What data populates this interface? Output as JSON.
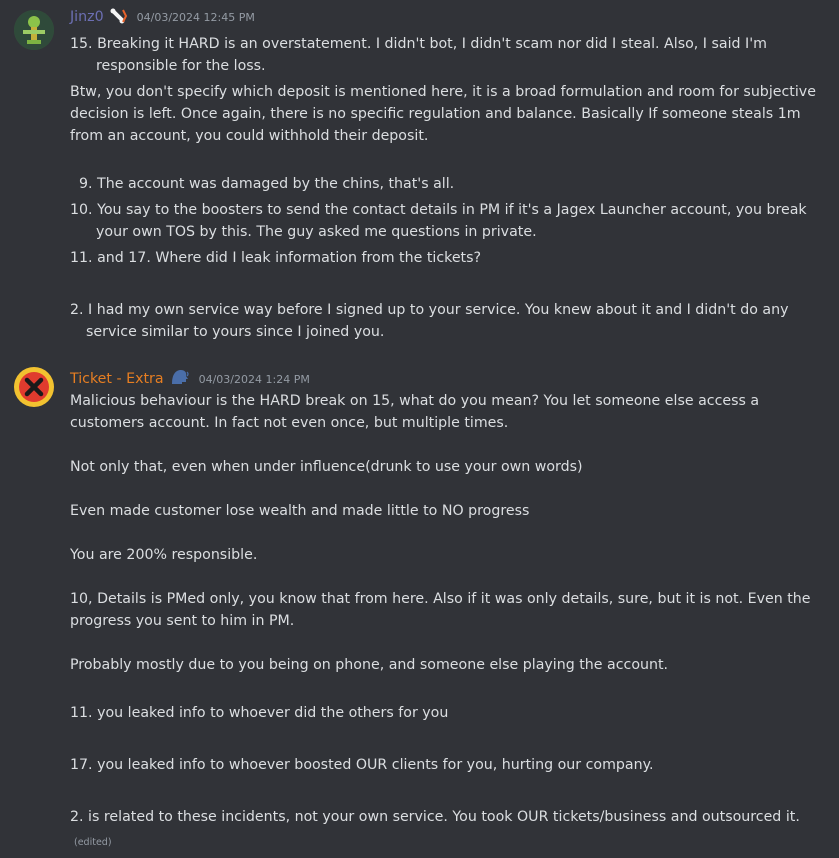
{
  "messages": [
    {
      "author": "Jinz0",
      "author_color": "#6c6fb3",
      "timestamp": "04/03/2024 12:45 PM",
      "badge_icon": "bone-icon",
      "lines": [
        "15. Breaking it HARD is an overstatement. I didn't bot, I didn't scam nor did I steal. Also, I said I'm",
        "responsible for the loss.",
        "Btw, you don't specify which deposit is mentioned here, it is a broad formulation and room for subjective",
        "decision is left. Once again, there is no specific regulation and balance. Basically If someone steals 1m",
        "from an account, you could withhold their deposit.",
        "9. The account was damaged by the chins, that's all.",
        "10. You say to the boosters to send the contact details in PM if it's a Jagex Launcher account, you break",
        "your own TOS by this. The guy asked me questions in private.",
        "11. and 17. Where did I leak information from the tickets?",
        "2. I had my own service way before I signed up to your service. You knew about it and I didn't do any",
        "service similar to yours since I joined you."
      ]
    },
    {
      "author": "Ticket - Extra",
      "author_color": "#e67e22",
      "timestamp": "04/03/2024 1:24 PM",
      "badge_icon": "speaking-head-icon",
      "lines": [
        "Malicious behaviour is the HARD break on 15, what do you mean? You let someone else access a",
        "customers account. In fact not even once, but multiple times.",
        "Not only that, even when under influence(drunk to use your own words)",
        "Even made customer lose wealth and made little to NO progress",
        "You are 200% responsible.",
        "10, Details is PMed only, you know that from here. Also if it was only details, sure, but it is not. Even the",
        "progress you sent to him in PM.",
        "Probably mostly due to you being on phone, and someone else playing the account.",
        "11. you leaked info to whoever did the others for you",
        "17. you leaked info to whoever boosted OUR clients for you, hurting our company.",
        "2. is related to these incidents, not your own service. You took OUR tickets/business and outsourced it."
      ],
      "edited_label": "(edited)"
    }
  ]
}
